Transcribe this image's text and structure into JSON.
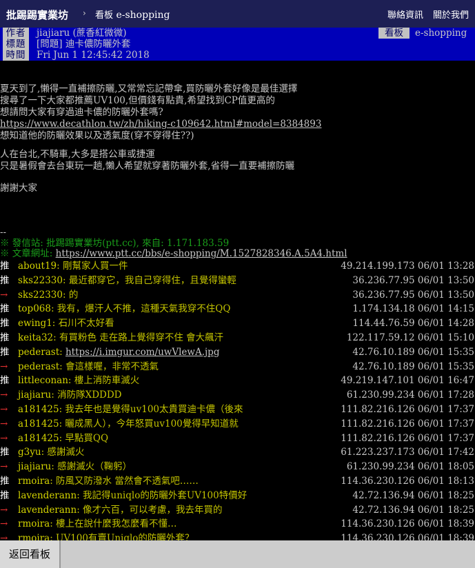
{
  "topbar": {
    "brand": "批踢踢實業坊",
    "separator": "›",
    "board_prefix": "看板",
    "board": "e-shopping",
    "links": [
      "聯絡資訊",
      "關於我們"
    ]
  },
  "header": {
    "author_label": "作者",
    "author": "jiajiaru (蔗香紅微微)",
    "board_label": "看板",
    "board": "e-shopping",
    "title_label": "標題",
    "title": "[問題] 迪卡儂防曬外套",
    "time_label": "時間",
    "time": "Fri Jun  1 12:45:42 2018"
  },
  "body": {
    "lines": [
      "夏天到了,懶得一直補擦防曬,又常常忘記帶傘,買防曬外套好像是最佳選擇",
      "搜尋了一下大家都推薦UV100,但價錢有點貴,希望找到CP值更高的",
      "想請問大家有穿過迪卡儂的防曬外套嗎?"
    ],
    "link": "https://www.decathlon.tw/zh/hiking-c109642.html#model=8384893",
    "line_after_link": "想知道他的防曬效果以及透氣度(穿不穿得住??)",
    "para2": [
      "人在台北,不騎車,大多是搭公車或捷運",
      "只是暑假會去台東玩一趟,懶人希望就穿著防曬外套,省得一直要補擦防曬"
    ],
    "thanks": "謝謝大家",
    "sig_dash": "--",
    "sig_site": "※ 發信站: 批踢踢實業坊(ptt.cc), 來自: 1.171.183.59",
    "sig_url_label": "※ 文章網址: ",
    "sig_url": "https://www.ptt.cc/bbs/e-shopping/M.1527828346.A.5A4.html"
  },
  "pushes": [
    {
      "tag": "推",
      "user": "about19",
      "content": ": 剛幫家人買一件",
      "ip": "49.214.199.173",
      "date": "06/01",
      "time": "13:28"
    },
    {
      "tag": "推",
      "user": "sks22330",
      "content": ": 最近都穿它，我自己穿得住，且覺得蠻輕",
      "ip": "36.236.77.95",
      "date": "06/01",
      "time": "13:50"
    },
    {
      "tag": "→",
      "user": "sks22330",
      "content": ": 的",
      "ip": "36.236.77.95",
      "date": "06/01",
      "time": "13:50"
    },
    {
      "tag": "推",
      "user": "top068",
      "content": ": 我有，爆汗人不推，這種天氣我穿不住QQ",
      "ip": "1.174.134.18",
      "date": "06/01",
      "time": "14:15"
    },
    {
      "tag": "推",
      "user": "ewing1",
      "content": ": 石川不太好看",
      "ip": "114.44.76.59",
      "date": "06/01",
      "time": "14:28"
    },
    {
      "tag": "推",
      "user": "keita32",
      "content": ": 有買粉色 走在路上覺得穿不住 會大飆汗",
      "ip": "122.117.59.12",
      "date": "06/01",
      "time": "15:10"
    },
    {
      "tag": "推",
      "user": "pederast",
      "content": ": ",
      "link": "https://i.imgur.com/uwVlewA.jpg",
      "ip": "42.76.10.189",
      "date": "06/01",
      "time": "15:35"
    },
    {
      "tag": "→",
      "user": "pederast",
      "content": ": 會這樣喔，非常不透氣",
      "ip": "42.76.10.189",
      "date": "06/01",
      "time": "15:35"
    },
    {
      "tag": "推",
      "user": "littleconan",
      "content": ": 樓上消防車滅火",
      "ip": "49.219.147.101",
      "date": "06/01",
      "time": "16:47"
    },
    {
      "tag": "→",
      "user": "jiajiaru",
      "content": ": 消防隊XDDDD",
      "ip": "61.230.99.234",
      "date": "06/01",
      "time": "17:28"
    },
    {
      "tag": "→",
      "user": "a181425",
      "content": ": 我去年也是覺得uv100太貴買迪卡儂（後來",
      "ip": "111.82.216.126",
      "date": "06/01",
      "time": "17:37"
    },
    {
      "tag": "→",
      "user": "a181425",
      "content": ": 曬成黑人），今年怒買uv100覺得早知道就",
      "ip": "111.82.216.126",
      "date": "06/01",
      "time": "17:37"
    },
    {
      "tag": "→",
      "user": "a181425",
      "content": ": 早點買QQ",
      "ip": "111.82.216.126",
      "date": "06/01",
      "time": "17:37"
    },
    {
      "tag": "推",
      "user": "g3yu",
      "content": ": 感謝滅火",
      "ip": "61.223.237.173",
      "date": "06/01",
      "time": "17:42"
    },
    {
      "tag": "→",
      "user": "jiajiaru",
      "content": ": 感謝滅火（鞠躬）",
      "ip": "61.230.99.234",
      "date": "06/01",
      "time": "18:05"
    },
    {
      "tag": "推",
      "user": "rmoira",
      "content": ": 防風又防潑水 當然會不透氣吧……",
      "ip": "114.36.230.126",
      "date": "06/01",
      "time": "18:13"
    },
    {
      "tag": "推",
      "user": "lavenderann",
      "content": ": 我記得uniqlo的防曬外套UV100特價好",
      "ip": "42.72.136.94",
      "date": "06/01",
      "time": "18:25"
    },
    {
      "tag": "→",
      "user": "lavenderann",
      "content": ": 像才六百，可以考慮，我去年買的",
      "ip": "42.72.136.94",
      "date": "06/01",
      "time": "18:25"
    },
    {
      "tag": "→",
      "user": "rmoira",
      "content": ": 樓上在說什麼我怎麼看不懂…",
      "ip": "114.36.230.126",
      "date": "06/01",
      "time": "18:39"
    },
    {
      "tag": "→",
      "user": "rmoira",
      "content": ": UV100有賣Uniqlo的防曬外套？",
      "ip": "114.36.230.126",
      "date": "06/01",
      "time": "18:39"
    }
  ],
  "bottom": {
    "back_label": "返回看板"
  }
}
